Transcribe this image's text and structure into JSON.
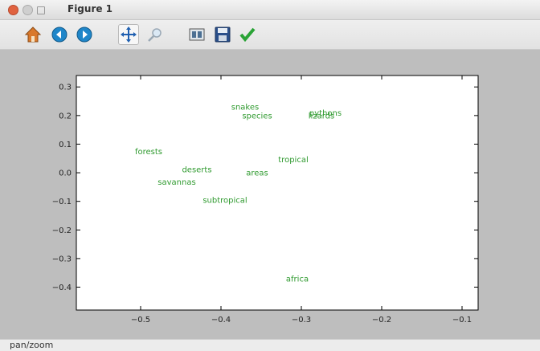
{
  "window": {
    "title": "Figure 1"
  },
  "toolbar": {
    "buttons": [
      {
        "name": "home-button",
        "icon": "home-icon"
      },
      {
        "name": "back-button",
        "icon": "arrow-left-icon"
      },
      {
        "name": "forward-button",
        "icon": "arrow-right-icon"
      },
      {
        "name": "pan-button",
        "icon": "move-icon"
      },
      {
        "name": "zoom-button",
        "icon": "zoom-icon"
      },
      {
        "name": "subplots-button",
        "icon": "subplots-icon"
      },
      {
        "name": "save-button",
        "icon": "save-icon"
      },
      {
        "name": "edit-button",
        "icon": "check-icon"
      }
    ]
  },
  "status": {
    "text": "pan/zoom"
  },
  "chart_data": {
    "type": "scatter",
    "xlim": [
      -0.58,
      -0.08
    ],
    "ylim": [
      -0.48,
      0.34
    ],
    "x_ticks": [
      -0.5,
      -0.4,
      -0.3,
      -0.2,
      -0.1
    ],
    "y_ticks": [
      0.3,
      0.2,
      0.1,
      0.0,
      -0.1,
      -0.2,
      -0.3,
      -0.4
    ],
    "x_tick_labels": [
      "−0.5",
      "−0.4",
      "−0.3",
      "−0.2",
      "−0.1"
    ],
    "y_tick_labels": [
      "0.3",
      "0.2",
      "0.1",
      "0.0",
      "−0.1",
      "−0.2",
      "−0.3",
      "−0.4"
    ],
    "grid": false,
    "label_color": "#2f9a2f",
    "points": [
      {
        "label": "snakes",
        "x": -0.37,
        "y": 0.23
      },
      {
        "label": "species",
        "x": -0.355,
        "y": 0.2
      },
      {
        "label": "pythons",
        "x": -0.27,
        "y": 0.21
      },
      {
        "label": "lizards",
        "x": -0.275,
        "y": 0.2
      },
      {
        "label": "forests",
        "x": -0.49,
        "y": 0.075
      },
      {
        "label": "tropical",
        "x": -0.31,
        "y": 0.047
      },
      {
        "label": "deserts",
        "x": -0.43,
        "y": 0.012
      },
      {
        "label": "areas",
        "x": -0.355,
        "y": 0.0
      },
      {
        "label": "savannas",
        "x": -0.455,
        "y": -0.032
      },
      {
        "label": "subtropical",
        "x": -0.395,
        "y": -0.095
      },
      {
        "label": "africa",
        "x": -0.305,
        "y": -0.37
      }
    ]
  }
}
